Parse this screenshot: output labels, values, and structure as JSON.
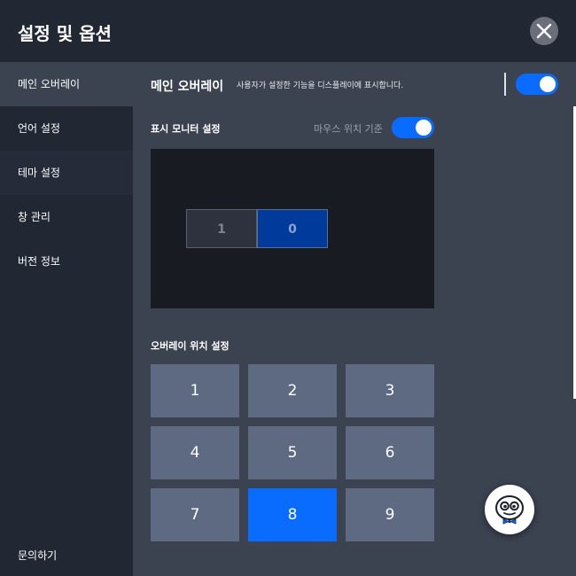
{
  "window": {
    "title": "설정 및 옵션"
  },
  "sidebar": {
    "items": [
      {
        "label": "메인 오버레이"
      },
      {
        "label": "언어 설정"
      },
      {
        "label": "테마 설정"
      },
      {
        "label": "창 관리"
      },
      {
        "label": "버전 정보"
      }
    ],
    "bottom_label": "문의하기"
  },
  "header": {
    "title": "메인 오버레이",
    "description": "사용자가 설정한 기능을 디스플레이에 표시합니다.",
    "toggle_on": true
  },
  "monitor": {
    "label": "표시 모니터 설정",
    "mouse_label": "마우스 위치 기준",
    "mouse_toggle_on": true,
    "screens": [
      "1",
      "0"
    ]
  },
  "overlay_position": {
    "label": "오버레이 위치 설정",
    "positions": [
      "1",
      "2",
      "3",
      "4",
      "5",
      "6",
      "7",
      "8",
      "9"
    ],
    "selected": "8"
  },
  "colors": {
    "accent": "#0a6cff",
    "sidebar_bg": "#222734",
    "content_bg": "#3b4250",
    "grid_btn": "#5d6a82",
    "monitor_bg": "#181b22"
  },
  "icons": {
    "close": "close-icon",
    "assistant": "mascot-icon"
  }
}
